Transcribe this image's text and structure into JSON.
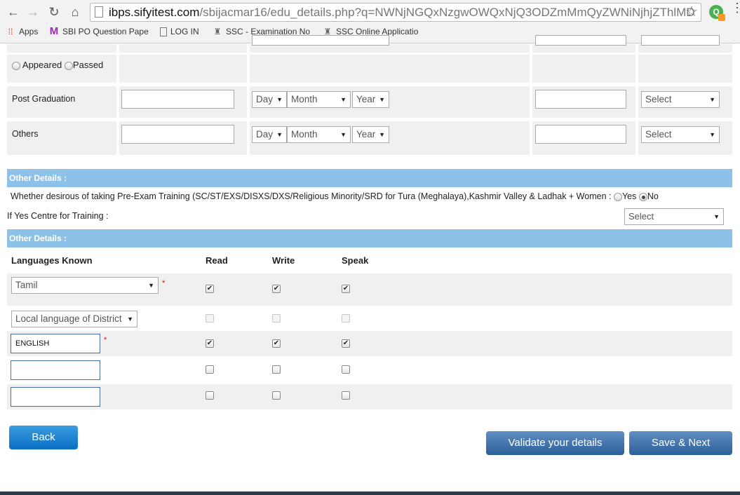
{
  "browser": {
    "url_host": "ibps.sifyitest.com",
    "url_path": "/sbijacmar16/edu_details.php?q=NWNjNGQxNzgwOWQxNjQ3ODZmMmQyZWNiNjhjZThlMD",
    "ext_letter": "Q",
    "bookmarks": [
      {
        "label": "Apps",
        "icon": "apps-grid-icon"
      },
      {
        "label": "SBI PO Question Pape",
        "icon": "m-logo-icon"
      },
      {
        "label": "LOG IN",
        "icon": "page-icon"
      },
      {
        "label": "SSC - Examination No",
        "icon": "emblem-icon"
      },
      {
        "label": "SSC Online Applicatio",
        "icon": "emblem-icon"
      }
    ]
  },
  "result_radios": {
    "appeared": "Appeared",
    "passed": "Passed"
  },
  "edu_rows": [
    {
      "label": "Post Graduation",
      "day": "Day",
      "month": "Month",
      "year": "Year",
      "select": "Select"
    },
    {
      "label": "Others",
      "day": "Day",
      "month": "Month",
      "year": "Year",
      "select": "Select"
    }
  ],
  "other_details_1": {
    "title": "Other Details :",
    "question": "Whether desirous of taking Pre-Exam Training (SC/ST/EXS/DISXS/DXS/Religious Minority/SRD for Tura (Meghalaya),Kashmir Valley & Ladhak + Women :",
    "yes": "Yes",
    "no": "No",
    "selected": "No",
    "centre_label": "If Yes Centre for Training :",
    "centre_select": "Select"
  },
  "other_details_2": {
    "title": "Other Details :",
    "headers": {
      "languages": "Languages Known",
      "read": "Read",
      "write": "Write",
      "speak": "Speak"
    },
    "rows": [
      {
        "type": "select",
        "value": "Tamil",
        "required": true,
        "read": true,
        "write": true,
        "speak": true,
        "disabled": false
      },
      {
        "type": "select",
        "value": "Local language of District",
        "required": false,
        "read": false,
        "write": false,
        "speak": false,
        "disabled": true
      },
      {
        "type": "input",
        "value": "ENGLISH",
        "required": true,
        "read": true,
        "write": true,
        "speak": true,
        "disabled": false
      },
      {
        "type": "input",
        "value": "",
        "required": false,
        "read": false,
        "write": false,
        "speak": false,
        "disabled": false
      },
      {
        "type": "input",
        "value": "",
        "required": false,
        "read": false,
        "write": false,
        "speak": false,
        "disabled": false
      }
    ]
  },
  "buttons": {
    "back": "Back",
    "validate": "Validate your details",
    "save": "Save & Next"
  },
  "required_mark": "*",
  "check_glyph": "✔"
}
